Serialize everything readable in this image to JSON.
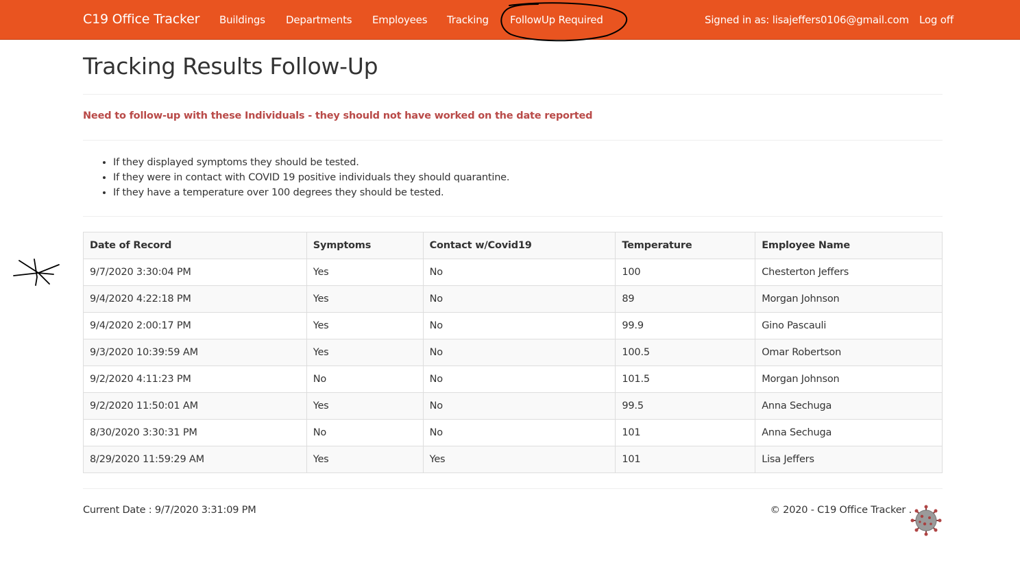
{
  "navbar": {
    "brand": "C19 Office Tracker",
    "items": [
      {
        "label": "Buildings"
      },
      {
        "label": "Departments"
      },
      {
        "label": "Employees"
      },
      {
        "label": "Tracking"
      },
      {
        "label": "FollowUp Required"
      }
    ],
    "signed_in": "Signed in as: lisajeffers0106@gmail.com",
    "logoff": "Log off",
    "accent_color": "#e95420"
  },
  "page": {
    "title": "Tracking Results Follow-Up",
    "warning": "Need to follow-up with these Individuals - they should not have worked on the date reported",
    "warning_color": "#b94a48",
    "guidance": [
      "If they displayed symptoms they should be tested.",
      "If they were in contact with COVID 19 positive individuals they should quarantine.",
      "If they have a temperature over 100 degrees they should be tested."
    ]
  },
  "table": {
    "headers": [
      "Date of Record",
      "Symptoms",
      "Contact w/Covid19",
      "Temperature",
      "Employee Name"
    ],
    "rows": [
      [
        "9/7/2020 3:30:04 PM",
        "Yes",
        "No",
        "100",
        "Chesterton Jeffers"
      ],
      [
        "9/4/2020 4:22:18 PM",
        "Yes",
        "No",
        "89",
        "Morgan Johnson"
      ],
      [
        "9/4/2020 2:00:17 PM",
        "Yes",
        "No",
        "99.9",
        "Gino Pascauli"
      ],
      [
        "9/3/2020 10:39:59 AM",
        "Yes",
        "No",
        "100.5",
        "Omar Robertson"
      ],
      [
        "9/2/2020 4:11:23 PM",
        "No",
        "No",
        "101.5",
        "Morgan Johnson"
      ],
      [
        "9/2/2020 11:50:01 AM",
        "Yes",
        "No",
        "99.5",
        "Anna Sechuga"
      ],
      [
        "8/30/2020 3:30:31 PM",
        "No",
        "No",
        "101",
        "Anna Sechuga"
      ],
      [
        "8/29/2020 11:59:29 AM",
        "Yes",
        "Yes",
        "101",
        "Lisa Jeffers"
      ]
    ]
  },
  "footer": {
    "current_date": "Current Date : 9/7/2020 3:31:09 PM",
    "copyright": "© 2020 - C19 Office Tracker .",
    "logo_icon": "coronavirus-icon"
  }
}
